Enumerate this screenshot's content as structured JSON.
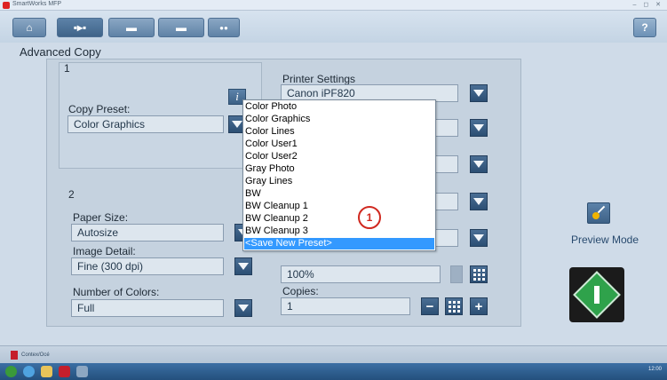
{
  "window": {
    "title": "SmartWorks MFP",
    "controls": "– ◻ ✕"
  },
  "toolbar": {
    "tabs": [
      {
        "name": "tab-home",
        "icon": "home-icon",
        "symbol": "⌂",
        "active": false
      },
      {
        "name": "tab-copy",
        "icon": "copy-icon",
        "symbol": "▪▸▪",
        "active": true
      },
      {
        "name": "tab-scan",
        "icon": "scan-icon",
        "symbol": "▬",
        "active": false
      },
      {
        "name": "tab-print",
        "icon": "print-icon",
        "symbol": "▬",
        "active": false
      },
      {
        "name": "tab-settings",
        "icon": "settings-icon",
        "symbol": "●●",
        "active": false
      }
    ],
    "help_label": "?"
  },
  "page": {
    "title": "Advanced Copy"
  },
  "group1": {
    "number": "1",
    "copy_preset_label": "Copy Preset:",
    "copy_preset_value": "Color Graphics",
    "info_label": "i"
  },
  "group2": {
    "number": "2",
    "paper_size_label": "Paper Size:",
    "paper_size_value": "Autosize",
    "image_detail_label": "Image Detail:",
    "image_detail_value": "Fine (300 dpi)",
    "colors_label": "Number of Colors:",
    "colors_value": "Full"
  },
  "printer": {
    "label": "Printer Settings",
    "printer_value": "Canon iPF820",
    "scale_value": "100%",
    "copies_label": "Copies:",
    "copies_value": "1",
    "minus": "−",
    "plus": "+"
  },
  "dropdown": {
    "options": [
      "Color Photo",
      "Color Graphics",
      "Color Lines",
      "Color User1",
      "Color User2",
      "Gray Photo",
      "Gray Lines",
      "BW",
      "BW Cleanup 1",
      "BW Cleanup 2",
      "BW Cleanup 3",
      "<Save New Preset>"
    ],
    "selected_index": 11
  },
  "callout": {
    "label": "1"
  },
  "preview": {
    "label": "Preview Mode"
  },
  "footer": {
    "brand": "Contex/Océ"
  },
  "tray": {
    "text": "12:00"
  }
}
